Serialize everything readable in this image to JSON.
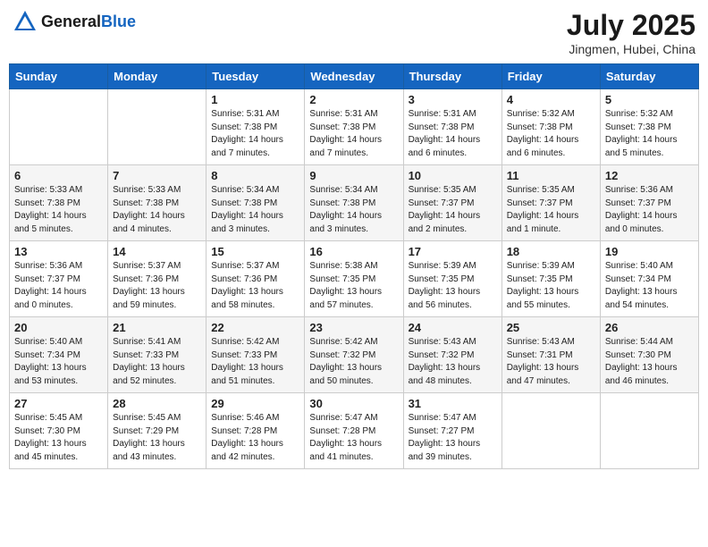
{
  "header": {
    "logo_general": "General",
    "logo_blue": "Blue",
    "month_year": "July 2025",
    "location": "Jingmen, Hubei, China"
  },
  "days_of_week": [
    "Sunday",
    "Monday",
    "Tuesday",
    "Wednesday",
    "Thursday",
    "Friday",
    "Saturday"
  ],
  "weeks": [
    [
      {
        "day": "",
        "info": ""
      },
      {
        "day": "",
        "info": ""
      },
      {
        "day": "1",
        "info": "Sunrise: 5:31 AM\nSunset: 7:38 PM\nDaylight: 14 hours and 7 minutes."
      },
      {
        "day": "2",
        "info": "Sunrise: 5:31 AM\nSunset: 7:38 PM\nDaylight: 14 hours and 7 minutes."
      },
      {
        "day": "3",
        "info": "Sunrise: 5:31 AM\nSunset: 7:38 PM\nDaylight: 14 hours and 6 minutes."
      },
      {
        "day": "4",
        "info": "Sunrise: 5:32 AM\nSunset: 7:38 PM\nDaylight: 14 hours and 6 minutes."
      },
      {
        "day": "5",
        "info": "Sunrise: 5:32 AM\nSunset: 7:38 PM\nDaylight: 14 hours and 5 minutes."
      }
    ],
    [
      {
        "day": "6",
        "info": "Sunrise: 5:33 AM\nSunset: 7:38 PM\nDaylight: 14 hours and 5 minutes."
      },
      {
        "day": "7",
        "info": "Sunrise: 5:33 AM\nSunset: 7:38 PM\nDaylight: 14 hours and 4 minutes."
      },
      {
        "day": "8",
        "info": "Sunrise: 5:34 AM\nSunset: 7:38 PM\nDaylight: 14 hours and 3 minutes."
      },
      {
        "day": "9",
        "info": "Sunrise: 5:34 AM\nSunset: 7:38 PM\nDaylight: 14 hours and 3 minutes."
      },
      {
        "day": "10",
        "info": "Sunrise: 5:35 AM\nSunset: 7:37 PM\nDaylight: 14 hours and 2 minutes."
      },
      {
        "day": "11",
        "info": "Sunrise: 5:35 AM\nSunset: 7:37 PM\nDaylight: 14 hours and 1 minute."
      },
      {
        "day": "12",
        "info": "Sunrise: 5:36 AM\nSunset: 7:37 PM\nDaylight: 14 hours and 0 minutes."
      }
    ],
    [
      {
        "day": "13",
        "info": "Sunrise: 5:36 AM\nSunset: 7:37 PM\nDaylight: 14 hours and 0 minutes."
      },
      {
        "day": "14",
        "info": "Sunrise: 5:37 AM\nSunset: 7:36 PM\nDaylight: 13 hours and 59 minutes."
      },
      {
        "day": "15",
        "info": "Sunrise: 5:37 AM\nSunset: 7:36 PM\nDaylight: 13 hours and 58 minutes."
      },
      {
        "day": "16",
        "info": "Sunrise: 5:38 AM\nSunset: 7:35 PM\nDaylight: 13 hours and 57 minutes."
      },
      {
        "day": "17",
        "info": "Sunrise: 5:39 AM\nSunset: 7:35 PM\nDaylight: 13 hours and 56 minutes."
      },
      {
        "day": "18",
        "info": "Sunrise: 5:39 AM\nSunset: 7:35 PM\nDaylight: 13 hours and 55 minutes."
      },
      {
        "day": "19",
        "info": "Sunrise: 5:40 AM\nSunset: 7:34 PM\nDaylight: 13 hours and 54 minutes."
      }
    ],
    [
      {
        "day": "20",
        "info": "Sunrise: 5:40 AM\nSunset: 7:34 PM\nDaylight: 13 hours and 53 minutes."
      },
      {
        "day": "21",
        "info": "Sunrise: 5:41 AM\nSunset: 7:33 PM\nDaylight: 13 hours and 52 minutes."
      },
      {
        "day": "22",
        "info": "Sunrise: 5:42 AM\nSunset: 7:33 PM\nDaylight: 13 hours and 51 minutes."
      },
      {
        "day": "23",
        "info": "Sunrise: 5:42 AM\nSunset: 7:32 PM\nDaylight: 13 hours and 50 minutes."
      },
      {
        "day": "24",
        "info": "Sunrise: 5:43 AM\nSunset: 7:32 PM\nDaylight: 13 hours and 48 minutes."
      },
      {
        "day": "25",
        "info": "Sunrise: 5:43 AM\nSunset: 7:31 PM\nDaylight: 13 hours and 47 minutes."
      },
      {
        "day": "26",
        "info": "Sunrise: 5:44 AM\nSunset: 7:30 PM\nDaylight: 13 hours and 46 minutes."
      }
    ],
    [
      {
        "day": "27",
        "info": "Sunrise: 5:45 AM\nSunset: 7:30 PM\nDaylight: 13 hours and 45 minutes."
      },
      {
        "day": "28",
        "info": "Sunrise: 5:45 AM\nSunset: 7:29 PM\nDaylight: 13 hours and 43 minutes."
      },
      {
        "day": "29",
        "info": "Sunrise: 5:46 AM\nSunset: 7:28 PM\nDaylight: 13 hours and 42 minutes."
      },
      {
        "day": "30",
        "info": "Sunrise: 5:47 AM\nSunset: 7:28 PM\nDaylight: 13 hours and 41 minutes."
      },
      {
        "day": "31",
        "info": "Sunrise: 5:47 AM\nSunset: 7:27 PM\nDaylight: 13 hours and 39 minutes."
      },
      {
        "day": "",
        "info": ""
      },
      {
        "day": "",
        "info": ""
      }
    ]
  ]
}
